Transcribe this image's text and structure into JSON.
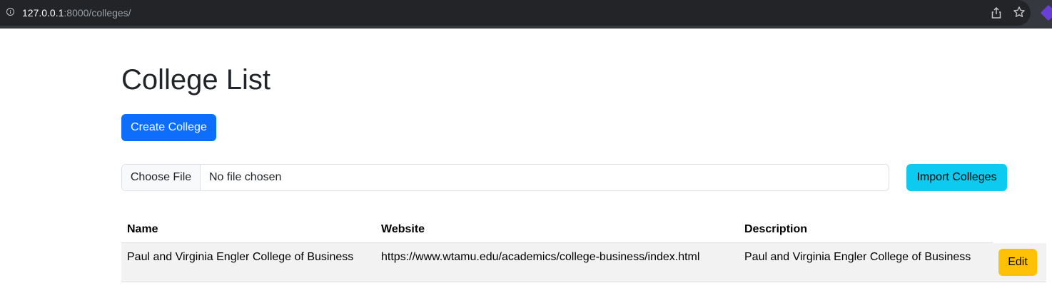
{
  "browser": {
    "url_host": "127.0.0.1",
    "url_path": ":8000/colleges/"
  },
  "page": {
    "title": "College List",
    "create_button": "Create College",
    "file_input": {
      "button_label": "Choose File",
      "status": "No file chosen"
    },
    "import_button": "Import Colleges"
  },
  "table": {
    "columns": [
      "Name",
      "Website",
      "Description"
    ],
    "rows": [
      {
        "name": "Paul and Virginia Engler College of Business",
        "website": "https://www.wtamu.edu/academics/college-business/index.html",
        "description": "Paul and Virginia Engler College of Business",
        "action_label": "Edit"
      }
    ]
  },
  "colors": {
    "primary": "#0d6efd",
    "info": "#0dcaf0",
    "warning": "#ffc107",
    "row_stripe": "#f2f2f2"
  }
}
